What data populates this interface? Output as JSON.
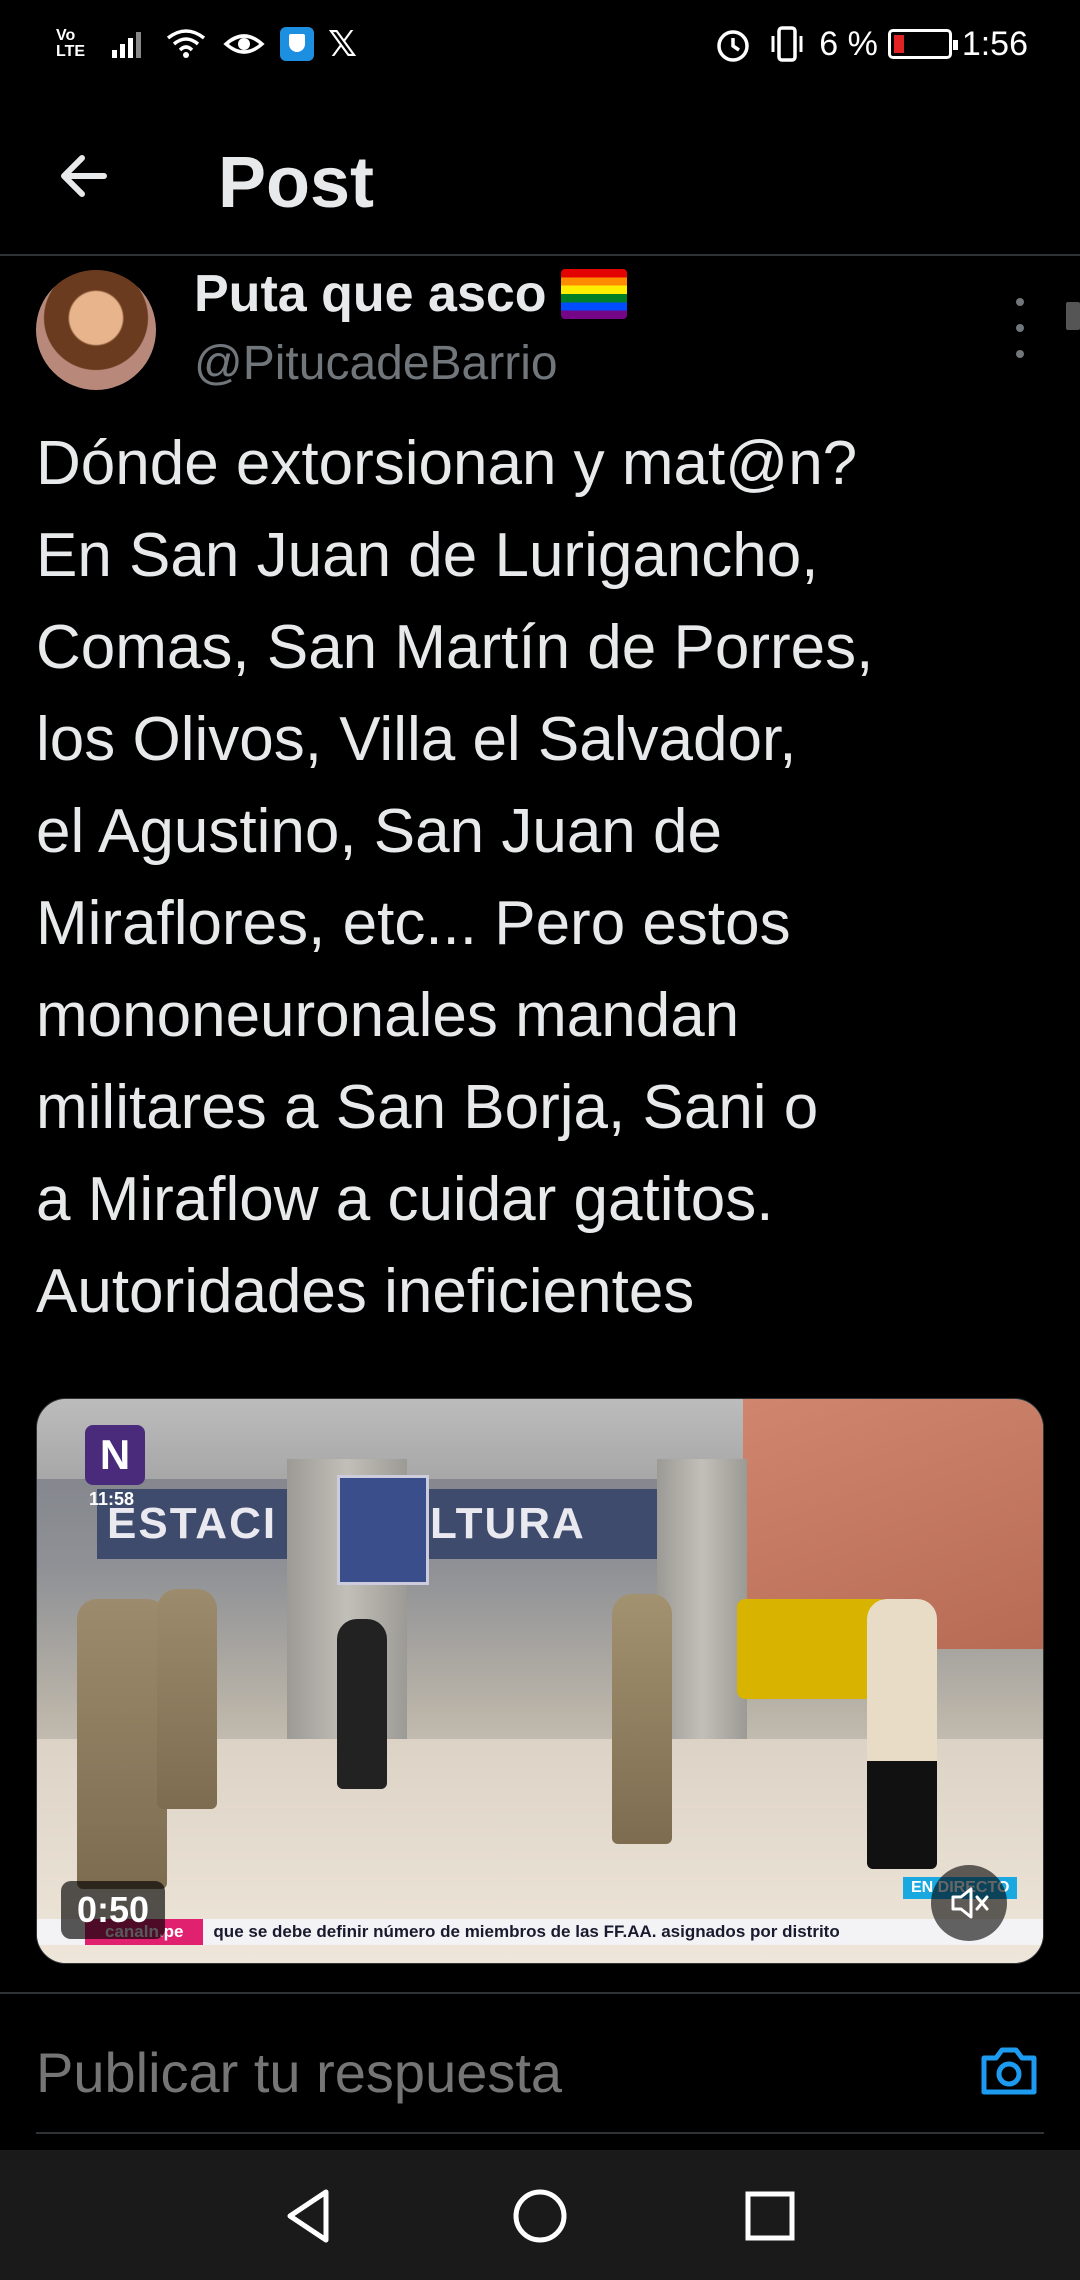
{
  "status_bar": {
    "volte": "Vo\nLTE",
    "battery_percent": "6 %",
    "time": "1:56",
    "icons": [
      "signal-icon",
      "wifi-icon",
      "eye-icon",
      "shield-icon",
      "x-logo-icon",
      "alarm-icon",
      "vibrate-icon",
      "battery-icon"
    ]
  },
  "header": {
    "title": "Post"
  },
  "post": {
    "display_name": "Puta que asco",
    "handle": "@PitucadeBarrio",
    "text": "Dónde extorsionan y mat@n?\nEn San Juan de Lurigancho,\nComas, San Martín de Porres,\nlos Olivos, Villa el Salvador,\nel Agustino, San Juan de\nMiraflores, etc... Pero estos\nmononeuronales mandan\nmilitares a San Borja, Sani o\na Miraflow a cuidar gatitos.\nAutoridades ineficientes"
  },
  "video": {
    "duration": "0:50",
    "channel_logo": "N",
    "channel_time": "11:58",
    "station_sign": "ESTACI      CULTURA",
    "ticker_source": "canaln.pe",
    "ticker_text": "que se debe definir número de miembros de las FF.AA. asignados por distrito",
    "live_label": "EN DIRECTO"
  },
  "reply": {
    "placeholder": "Publicar tu respuesta"
  },
  "colors": {
    "background": "#000000",
    "text_primary": "#e7e9ea",
    "text_secondary": "#71767b",
    "accent": "#1d9bf0",
    "divider": "#2f3336"
  }
}
